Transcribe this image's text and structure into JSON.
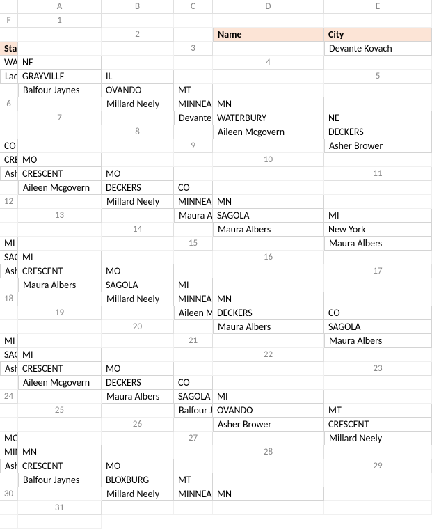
{
  "columns": [
    "A",
    "B",
    "C",
    "D",
    "E",
    "F"
  ],
  "rowCount": 31,
  "headers": {
    "name": "Name",
    "city": "City",
    "state": "State"
  },
  "rows": [
    {
      "name": "Devante Kovach",
      "city": "WATERBURY",
      "state": "NE"
    },
    {
      "name": "Ladonna Keller",
      "city": "GRAYVILLE",
      "state": "IL"
    },
    {
      "name": "Balfour Jaynes",
      "city": "OVANDO",
      "state": "MT"
    },
    {
      "name": "Millard Neely",
      "city": "MINNEAPOLIS",
      "state": "MN"
    },
    {
      "name": "Devante Kovach",
      "city": "WATERBURY",
      "state": "NE"
    },
    {
      "name": "Aileen Mcgovern",
      "city": "DECKERS",
      "state": "CO"
    },
    {
      "name": "Asher Brower",
      "city": "CRESCENT",
      "state": "MO"
    },
    {
      "name": "Asher Brower",
      "city": "CRESCENT",
      "state": "MO"
    },
    {
      "name": "Aileen Mcgovern",
      "city": "DECKERS",
      "state": "CO"
    },
    {
      "name": "Millard Neely",
      "city": "MINNEAPOLIS",
      "state": "MN"
    },
    {
      "name": "Maura Albers",
      "city": "SAGOLA",
      "state": "MI"
    },
    {
      "name": "Maura Albers",
      "city": "New York",
      "state": "MI"
    },
    {
      "name": "Maura Albers",
      "city": "SAGOLA",
      "state": "MI"
    },
    {
      "name": "Asher Brower",
      "city": "CRESCENT",
      "state": "MO"
    },
    {
      "name": "Maura Albers",
      "city": "SAGOLA",
      "state": "MI"
    },
    {
      "name": "Millard Neely",
      "city": "MINNEAPOLIS",
      "state": "MN"
    },
    {
      "name": "Aileen Mcgovern",
      "city": "DECKERS",
      "state": "CO"
    },
    {
      "name": "Maura Albers",
      "city": "SAGOLA",
      "state": "MI"
    },
    {
      "name": "Maura Albers",
      "city": "SAGOLA",
      "state": "MI"
    },
    {
      "name": "Asher Brower",
      "city": "CRESCENT",
      "state": "MO"
    },
    {
      "name": "Aileen Mcgovern",
      "city": "DECKERS",
      "state": "CO"
    },
    {
      "name": "Maura Albers",
      "city": "SAGOLA",
      "state": "MI"
    },
    {
      "name": "Balfour Jaynes",
      "city": "OVANDO",
      "state": "MT"
    },
    {
      "name": "Asher Brower",
      "city": "CRESCENT",
      "state": "MO"
    },
    {
      "name": "Millard Neely",
      "city": "MINNEAPOLIS",
      "state": "MN"
    },
    {
      "name": "Asher Brower",
      "city": "CRESCENT",
      "state": "MO"
    },
    {
      "name": "Balfour Jaynes",
      "city": "BLOXBURG",
      "state": "MT"
    },
    {
      "name": "Millard Neely",
      "city": "MINNEAPOLIS",
      "state": "MN"
    }
  ]
}
